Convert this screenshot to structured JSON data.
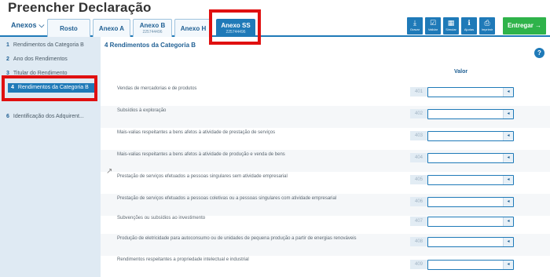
{
  "page_title": "Preencher Declaração",
  "tabs": {
    "anexos_label": "Anexos",
    "items": [
      {
        "label": "Rosto",
        "sub": ""
      },
      {
        "label": "Anexo A",
        "sub": ""
      },
      {
        "label": "Anexo B",
        "sub": "225744496"
      },
      {
        "label": "Anexo H",
        "sub": ""
      },
      {
        "label": "Anexo SS",
        "sub": "225744496"
      }
    ]
  },
  "toolbar": {
    "buttons": [
      {
        "label": "Gravar",
        "icon": "download-icon"
      },
      {
        "label": "Validar",
        "icon": "check-icon"
      },
      {
        "label": "Simular",
        "icon": "calculator-icon"
      },
      {
        "label": "Ajudas",
        "icon": "info-icon"
      },
      {
        "label": "Imprimir",
        "icon": "print-icon"
      }
    ],
    "enter_label": "Entregar →"
  },
  "sidebar": {
    "items": [
      {
        "num": "1",
        "label": "Rendimentos da Categoria B"
      },
      {
        "num": "2",
        "label": "Ano dos Rendimentos"
      },
      {
        "num": "3",
        "label": "Titular do Rendimento"
      },
      {
        "num": "4",
        "label": "Rendimentos da Categoria B"
      },
      {
        "num": "6",
        "label": "Identificação dos Adquirent..."
      }
    ]
  },
  "main": {
    "section_title": "4  Rendimentos da Categoria B",
    "help": "?",
    "column_header": "Valor",
    "rows": [
      {
        "label": "Vendas de mercadorias e de produtos",
        "code": "401",
        "value": ""
      },
      {
        "label": "Subsídios à exploração",
        "code": "402",
        "value": ""
      },
      {
        "label": "Mais-valias respeitantes a bens afetos à atividade de prestação de serviços",
        "code": "403",
        "value": ""
      },
      {
        "label": "Mais-valias respeitantes a bens afetos à atividade de produção e venda de bens",
        "code": "404",
        "value": ""
      },
      {
        "label": "Prestação de serviços efetuados a pessoas singulares sem atividade empresarial",
        "code": "405",
        "value": ""
      },
      {
        "label": "Prestação de serviços efetuados a pessoas coletivas ou a pessoas singulares com atividade empresarial",
        "code": "406",
        "value": ""
      },
      {
        "label": "Subvenções ou subsídios ao investimento",
        "code": "407",
        "value": ""
      },
      {
        "label": "Produção de eletricidade para autoconsumo ou de unidades de pequena produção a partir de energias renováveis",
        "code": "408",
        "value": ""
      },
      {
        "label": "Rendimentos respeitantes a propriedade intelectual e industrial",
        "code": "409",
        "value": ""
      }
    ]
  },
  "colors": {
    "primary": "#1f7ab8",
    "sidebar_bg": "#dfeaf3",
    "enter_green": "#2fb34a",
    "highlight_red": "#e01010"
  }
}
